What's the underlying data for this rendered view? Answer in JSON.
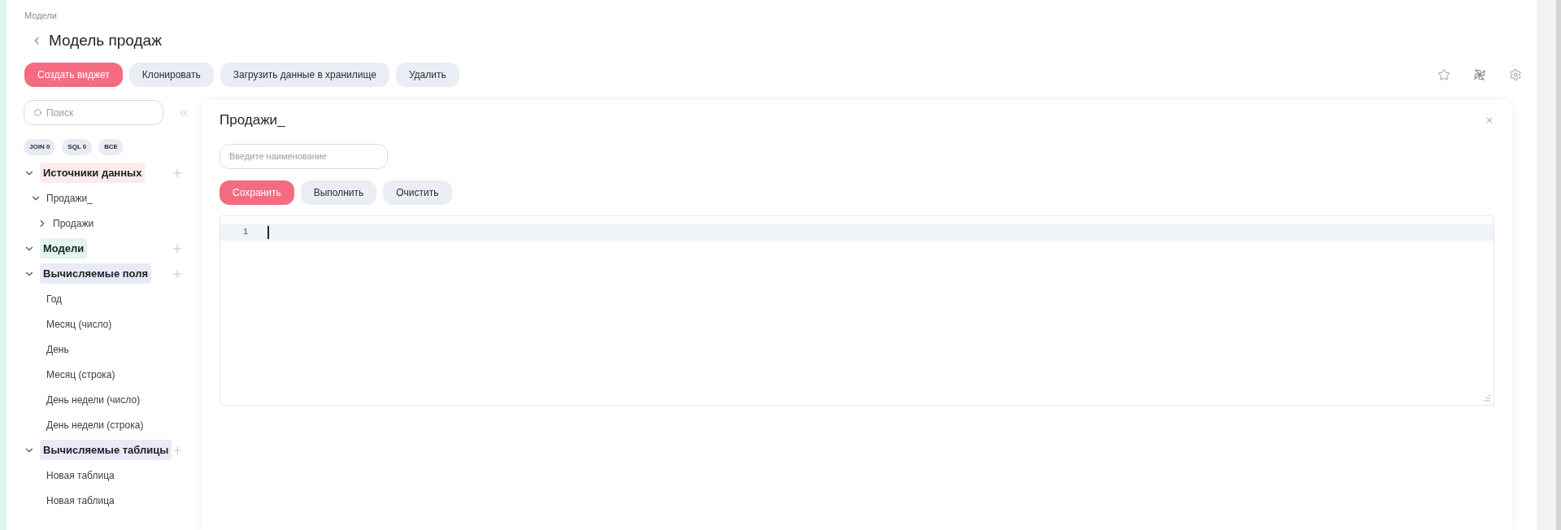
{
  "breadcrumb": "Модели",
  "title": "Модель продаж",
  "actions": [
    {
      "label": "Создать виджет",
      "kind": "primary"
    },
    {
      "label": "Клонировать",
      "kind": "secondary"
    },
    {
      "label": "Загрузить данные в хранилище",
      "kind": "secondary"
    },
    {
      "label": "Удалить",
      "kind": "secondary"
    }
  ],
  "sidebar": {
    "search": {
      "placeholder": "Поиск"
    },
    "filters": [
      {
        "label": "JOIN 0"
      },
      {
        "label": "SQL 0"
      },
      {
        "label": "ВСЕ"
      }
    ],
    "tree": [
      {
        "label": "Источники данных",
        "kind": "section",
        "color": "#fcebea",
        "expanded": true,
        "children": [
          {
            "label": "Продажи_",
            "expanded": true,
            "children": [
              {
                "label": "Продажи",
                "expanded": false
              }
            ]
          }
        ]
      },
      {
        "label": "Модели",
        "kind": "section",
        "color": "#e2f5ea",
        "expanded": true
      },
      {
        "label": "Вычисляемые поля",
        "kind": "section",
        "color": "#e8ebf5",
        "expanded": true,
        "children": [
          {
            "label": "Год"
          },
          {
            "label": "Месяц (число)"
          },
          {
            "label": "День"
          },
          {
            "label": "Месяц (строка)"
          },
          {
            "label": "День недели (число)"
          },
          {
            "label": "День недели (строка)"
          }
        ]
      },
      {
        "label": "Вычисляемые таблицы",
        "kind": "section",
        "color": "#ebe8f7",
        "expanded": true,
        "children": [
          {
            "label": "Новая таблица"
          },
          {
            "label": "Новая таблица"
          }
        ]
      }
    ]
  },
  "panel": {
    "title": "Продажи_",
    "name_field": {
      "placeholder": "Введите наименование"
    },
    "buttons": [
      {
        "label": "Сохранить",
        "kind": "primary"
      },
      {
        "label": "Выполнить",
        "kind": "secondary"
      },
      {
        "label": "Очистить",
        "kind": "secondary"
      }
    ],
    "editor": {
      "line_numbers": [
        "1"
      ]
    }
  }
}
